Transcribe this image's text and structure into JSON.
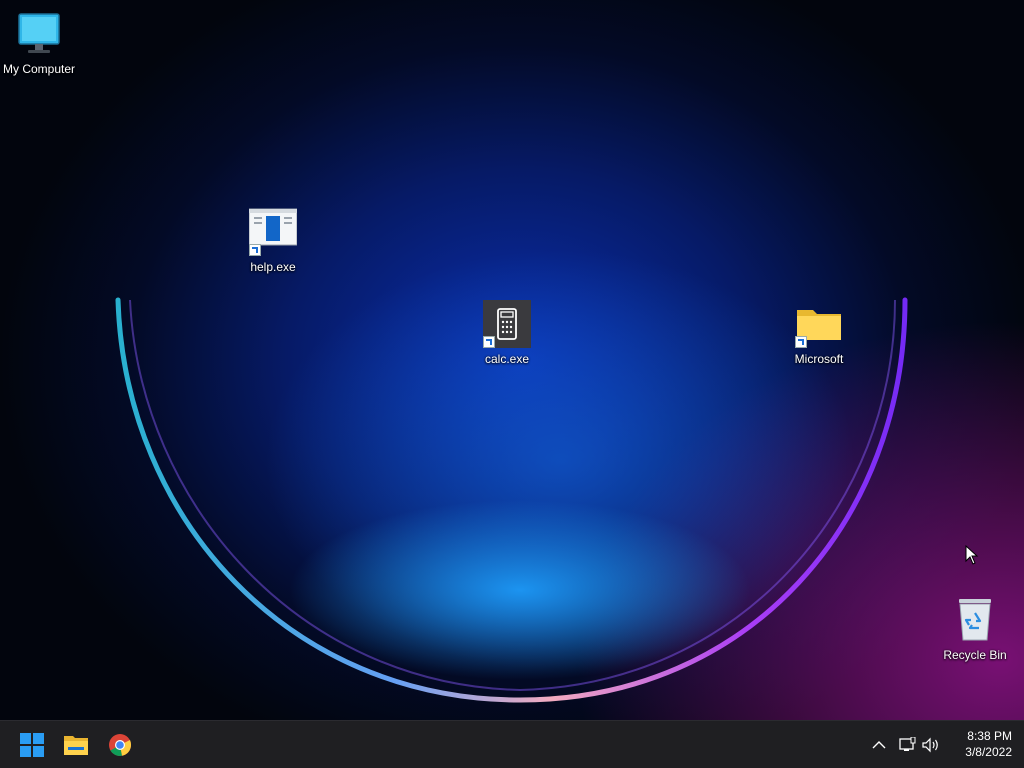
{
  "desktop": {
    "icons": [
      {
        "name": "My Computer",
        "type": "computer"
      },
      {
        "name": "help.exe",
        "type": "shortcut"
      },
      {
        "name": "calc.exe",
        "type": "shortcut"
      },
      {
        "name": "Microsoft",
        "type": "folder-shortcut"
      },
      {
        "name": "Recycle Bin",
        "type": "recycle-bin"
      }
    ]
  },
  "taskbar": {
    "pinned": [
      {
        "icon": "windows-start-icon"
      },
      {
        "icon": "file-explorer-icon"
      },
      {
        "icon": "chrome-icon"
      }
    ],
    "tray": [
      {
        "icon": "chevron-up-icon"
      },
      {
        "icon": "network-icon"
      },
      {
        "icon": "volume-icon"
      }
    ],
    "clock": {
      "time": "8:38 PM",
      "date": "3/8/2022"
    }
  },
  "colors": {
    "taskbar_bg": "#1f1f22",
    "accent_blue": "#0a2fb0",
    "accent_magenta": "#a0149a"
  }
}
